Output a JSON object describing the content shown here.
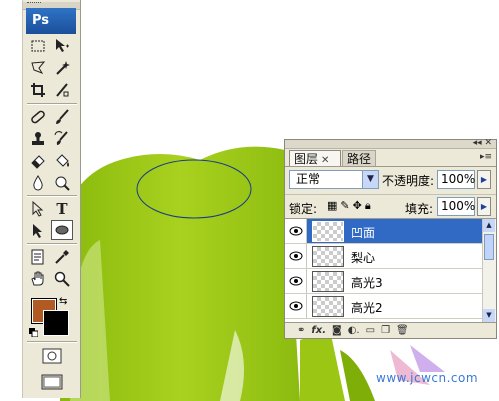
{
  "toolbox": {
    "logo": "Ps",
    "foreground_color": "#b25a23",
    "background_color": "#000000",
    "tools": [
      "marquee-icon",
      "move-icon",
      "lasso-icon",
      "magic-wand-icon",
      "crop-icon",
      "slice-icon",
      "healing-brush-icon",
      "brush-icon",
      "clone-stamp-icon",
      "history-brush-icon",
      "eraser-icon",
      "paint-bucket-icon",
      "blur-icon",
      "dodge-icon",
      "path-selection-icon",
      "type-icon",
      "direct-selection-icon",
      "ellipse-icon",
      "notes-icon",
      "eyedropper-icon",
      "hand-icon",
      "zoom-icon",
      "quick-mask-icon",
      "screen-mode-icon"
    ]
  },
  "layers_panel": {
    "tabs": [
      {
        "label": "图层",
        "active": true
      },
      {
        "label": "路径",
        "active": false
      }
    ],
    "blend_mode": "正常",
    "opacity_label": "不透明度:",
    "opacity_value": "100%",
    "lock_label": "锁定:",
    "fill_label": "填充:",
    "fill_value": "100%",
    "layers": [
      {
        "name": "凹面",
        "selected": true
      },
      {
        "name": "梨心",
        "selected": false
      },
      {
        "name": "高光3",
        "selected": false
      },
      {
        "name": "高光2",
        "selected": false
      }
    ],
    "bottom_icons": [
      "link-icon",
      "fx-icon",
      "mask-icon",
      "adjustment-icon",
      "group-icon",
      "new-layer-icon",
      "trash-icon"
    ]
  },
  "canvas": {
    "pear_color": "#9bc614",
    "selection_shape": "ellipse"
  },
  "watermark": "www.jcwcn.com"
}
